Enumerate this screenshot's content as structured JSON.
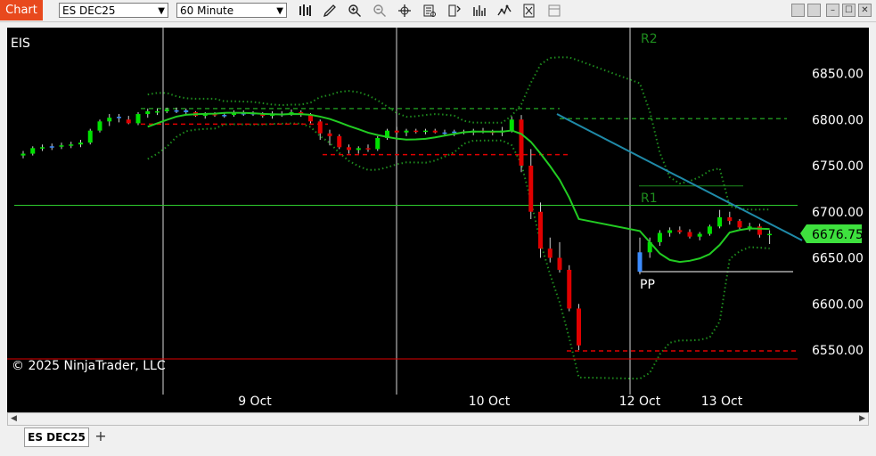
{
  "toolbar": {
    "chart_tab": "Chart",
    "instrument": "ES DEC25",
    "interval": "60 Minute",
    "icons": [
      "bar-type-icon",
      "draw-tool-icon",
      "zoom-in-icon",
      "zoom-out-icon",
      "crosshair-icon",
      "data-box-icon",
      "properties-icon",
      "indicators-icon",
      "strategies-icon",
      "templates-icon",
      "hide-tabs-icon"
    ]
  },
  "chart": {
    "label": "EIS",
    "copyright": "© 2025 NinjaTrader, LLC",
    "price_label": "6676.75",
    "pivot_labels": {
      "r2": "R2",
      "r1": "R1",
      "pp": "PP"
    },
    "y_ticks": [
      "6850.00",
      "6800.00",
      "6750.00",
      "6700.00",
      "6650.00",
      "6600.00",
      "6550.00"
    ],
    "x_ticks": [
      "9 Oct",
      "10 Oct",
      "12 Oct",
      "13 Oct"
    ]
  },
  "tabs": {
    "active": "ES DEC25",
    "add": "+"
  },
  "colors": {
    "up": "#00e100",
    "down": "#e00000",
    "flat": "#3c8cff",
    "ma": "#22cc22",
    "band": "#1e8c1e",
    "trend": "#1f8aa8",
    "price_box": "#3ee13e"
  },
  "chart_data": {
    "type": "candlestick",
    "instrument": "ES DEC25",
    "interval": "60 Minute",
    "y_ticks": [
      6850,
      6800,
      6750,
      6700,
      6650,
      6600,
      6550
    ],
    "x_ticks": [
      "9 Oct",
      "10 Oct",
      "12 Oct",
      "13 Oct"
    ],
    "last_price": 6676.75,
    "levels": {
      "R1": 6707,
      "R2": 6877,
      "PP": 6635
    },
    "candles": [
      [
        6761,
        6766,
        6758,
        6763
      ],
      [
        6763,
        6771,
        6761,
        6769
      ],
      [
        6769,
        6773,
        6766,
        6770
      ],
      [
        6770,
        6774,
        6767,
        6771
      ],
      [
        6771,
        6775,
        6768,
        6772
      ],
      [
        6772,
        6776,
        6769,
        6773
      ],
      [
        6773,
        6778,
        6770,
        6775
      ],
      [
        6775,
        6790,
        6773,
        6788
      ],
      [
        6788,
        6800,
        6786,
        6798
      ],
      [
        6798,
        6806,
        6793,
        6802
      ],
      [
        6802,
        6806,
        6797,
        6803
      ],
      [
        6800,
        6804,
        6795,
        6796
      ],
      [
        6796,
        6808,
        6794,
        6806
      ],
      [
        6806,
        6812,
        6802,
        6809
      ],
      [
        6808,
        6812,
        6805,
        6809
      ],
      [
        6809,
        6813,
        6807,
        6811
      ],
      [
        6810,
        6813,
        6807,
        6810
      ],
      [
        6810,
        6812,
        6806,
        6808
      ],
      [
        6808,
        6809,
        6803,
        6804
      ],
      [
        6804,
        6808,
        6801,
        6806
      ],
      [
        6806,
        6808,
        6803,
        6805
      ],
      [
        6805,
        6808,
        6802,
        6805
      ],
      [
        6805,
        6810,
        6803,
        6807
      ],
      [
        6807,
        6810,
        6804,
        6807
      ],
      [
        6807,
        6809,
        6804,
        6806
      ],
      [
        6806,
        6808,
        6802,
        6804
      ],
      [
        6804,
        6809,
        6801,
        6806
      ],
      [
        6806,
        6809,
        6803,
        6806
      ],
      [
        6806,
        6811,
        6804,
        6808
      ],
      [
        6808,
        6810,
        6803,
        6805
      ],
      [
        6805,
        6807,
        6796,
        6798
      ],
      [
        6798,
        6800,
        6778,
        6785
      ],
      [
        6785,
        6789,
        6772,
        6782
      ],
      [
        6782,
        6784,
        6768,
        6770
      ],
      [
        6770,
        6773,
        6763,
        6767
      ],
      [
        6767,
        6771,
        6763,
        6769
      ],
      [
        6769,
        6773,
        6765,
        6768
      ],
      [
        6768,
        6782,
        6766,
        6780
      ],
      [
        6780,
        6790,
        6778,
        6788
      ],
      [
        6788,
        6792,
        6784,
        6786
      ],
      [
        6786,
        6790,
        6782,
        6788
      ],
      [
        6788,
        6790,
        6785,
        6787
      ],
      [
        6787,
        6790,
        6784,
        6788
      ],
      [
        6788,
        6790,
        6785,
        6786
      ],
      [
        6786,
        6789,
        6783,
        6786
      ],
      [
        6786,
        6789,
        6782,
        6787
      ],
      [
        6787,
        6789,
        6784,
        6786
      ],
      [
        6786,
        6790,
        6783,
        6788
      ],
      [
        6788,
        6791,
        6785,
        6787
      ],
      [
        6787,
        6789,
        6783,
        6786
      ],
      [
        6786,
        6792,
        6782,
        6788
      ],
      [
        6788,
        6803,
        6786,
        6800
      ],
      [
        6800,
        6805,
        6743,
        6750
      ],
      [
        6750,
        6768,
        6692,
        6700
      ],
      [
        6700,
        6710,
        6650,
        6660
      ],
      [
        6660,
        6672,
        6645,
        6650
      ],
      [
        6650,
        6667,
        6634,
        6637
      ],
      [
        6637,
        6642,
        6592,
        6595
      ],
      [
        6595,
        6600,
        6550,
        6555
      ],
      [
        6635,
        6672,
        6632,
        6656
      ],
      [
        6656,
        6672,
        6650,
        6667
      ],
      [
        6667,
        6680,
        6663,
        6677
      ],
      [
        6677,
        6683,
        6673,
        6680
      ],
      [
        6680,
        6684,
        6676,
        6678
      ],
      [
        6678,
        6681,
        6671,
        6673
      ],
      [
        6673,
        6678,
        6669,
        6676
      ],
      [
        6676,
        6686,
        6674,
        6684
      ],
      [
        6684,
        6702,
        6682,
        6694
      ],
      [
        6694,
        6700,
        6686,
        6690
      ],
      [
        6690,
        6692,
        6681,
        6683
      ],
      [
        6683,
        6688,
        6679,
        6684
      ],
      [
        6684,
        6687,
        6672,
        6675
      ],
      [
        6675,
        6680,
        6665,
        6676
      ]
    ]
  }
}
